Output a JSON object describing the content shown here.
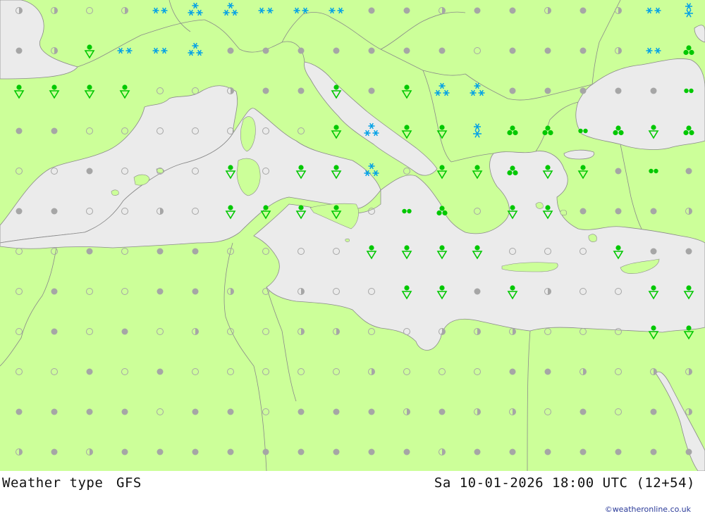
{
  "footer": {
    "title": "Weather type",
    "model": "GFS",
    "valid_time": "Sa 10-01-2026 18:00 UTC (12+54)",
    "credit": "©weatheronline.co.uk"
  },
  "colors": {
    "land": "#ccff99",
    "sea": "#ebebeb",
    "border": "#8a8a8a",
    "rain": "#00c800",
    "snow": "#00a0e6",
    "overcast": "#a6a6a6",
    "partly_cloudy": "#a6a6a6",
    "clear": "#a6a6a6"
  },
  "legend_symbols": {
    "O": "overcast-dot",
    "H": "partly-cloudy-half-circle",
    "C": "clear-circle",
    "R": "rain-shower-icon",
    "S": "snow-icon",
    "W": "snow-shower-icon",
    "T": "thunderstorm-clover-icon",
    "D": "drizzle-two-drops-icon",
    "X": "heavy-snow-icon"
  },
  "grid": {
    "columns": 20,
    "rows": 12,
    "row_codes": [
      "HHCHSWWSSSOOHOOHOHSX",
      "OHRSSWOOOOOOOCOOOHST",
      "RRRRCCHOORORWWOOOOOD",
      "OOCCCCCCCRWRRXTTDTRT",
      "CCOCCCRCRRWCRRTRRODO",
      "OOCCHCRRRRCDTCRROOOH",
      "CCOCOOCCCCRRRRCCCROO",
      "COCCOOHCHCCRRORHCCRR",
      "COCOCHCCHHCCHHHCCCRR",
      "CCOCOCCCCCHCCCOOHCHH",
      "OOOOCOOCOOOHOHHCOCOH",
      "HOHOOOOOOOOOHOOOOOOO"
    ]
  }
}
